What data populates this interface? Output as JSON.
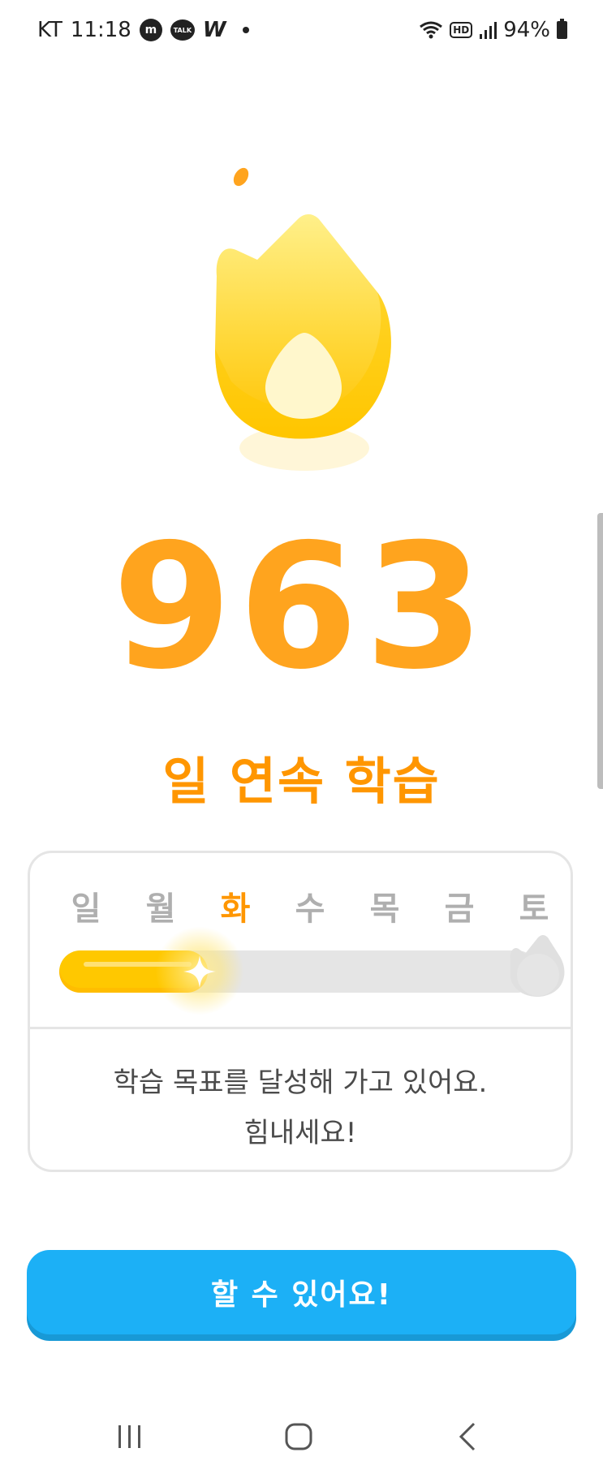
{
  "status_bar": {
    "carrier": "KT",
    "time": "11:18",
    "notif_icons": [
      "m-app-icon",
      "kakaotalk-icon",
      "w-app-icon"
    ],
    "talk_label": "TALK",
    "m_label": "m",
    "w_label": "W",
    "hd_label": "HD",
    "battery": "94%"
  },
  "streak": {
    "count": "963",
    "label": "일 연속 학습"
  },
  "week": {
    "days": [
      "일",
      "월",
      "화",
      "수",
      "목",
      "금",
      "토"
    ],
    "active_index": 2,
    "progress_fraction": 0.31
  },
  "message": {
    "line1": "학습 목표를 달성해 가고 있어요.",
    "line2": "힘내세요!"
  },
  "cta": {
    "label": "할 수 있어요!"
  },
  "colors": {
    "accent_orange": "#ff9600",
    "streak_gold": "#ffc800",
    "button_blue": "#1cb0f6",
    "track_gray": "#e5e5e5"
  }
}
